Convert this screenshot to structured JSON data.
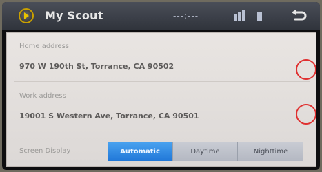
{
  "app": {
    "title": "My Scout"
  },
  "status": {
    "dashes": "---:---"
  },
  "fields": [
    {
      "label": "Home address",
      "value": "970 W 190th St, Torrance, CA 90502"
    },
    {
      "label": "Work address",
      "value": "19001 S Western Ave, Torrance, CA 90501"
    }
  ],
  "screen_display": {
    "label": "Screen Display",
    "options": [
      "Automatic",
      "Daytime",
      "Nighttime"
    ],
    "selected": "Automatic"
  },
  "colors": {
    "accent_active": "#2a86e0",
    "highlight_circle": "#e03030"
  },
  "icons": {
    "logo": "scout-logo-icon",
    "back": "back-arrow-icon"
  }
}
